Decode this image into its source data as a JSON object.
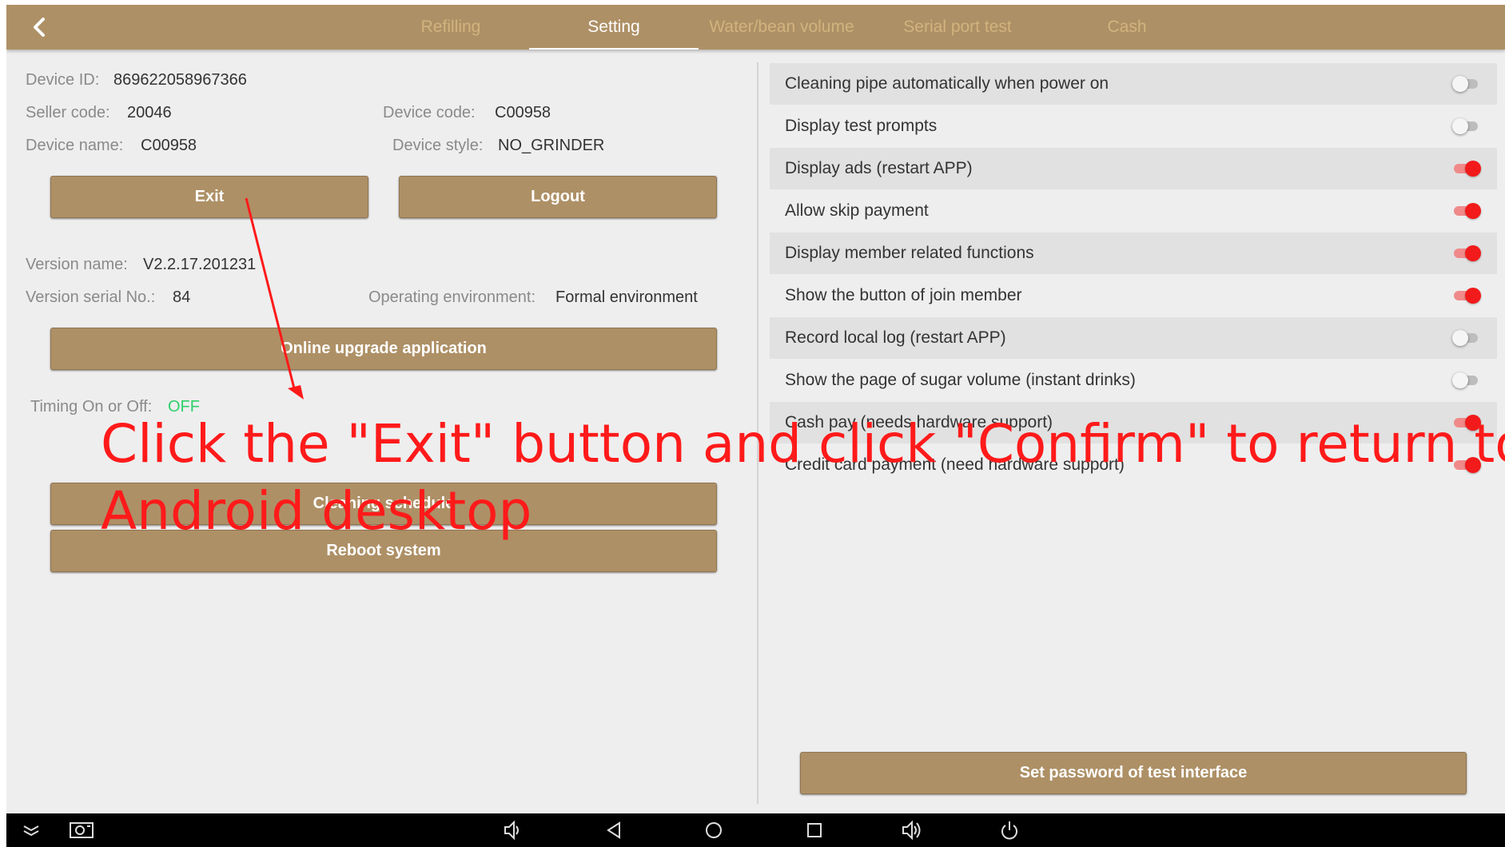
{
  "header": {
    "back_icon": "chevron-left-icon",
    "tabs": [
      {
        "label": "Refilling",
        "active": false
      },
      {
        "label": "Setting",
        "active": true
      },
      {
        "label": "Water/bean volume",
        "active": false
      },
      {
        "label": "Serial port test",
        "active": false
      },
      {
        "label": "Cash",
        "active": false
      }
    ]
  },
  "device": {
    "id_label": "Device ID:",
    "id_value": "869622058967366",
    "seller_label": "Seller code:",
    "seller_value": "20046",
    "code_label": "Device code:",
    "code_value": "C00958",
    "name_label": "Device name:",
    "name_value": "C00958",
    "style_label": "Device style:",
    "style_value": "NO_GRINDER"
  },
  "buttons": {
    "exit": "Exit",
    "logout": "Logout",
    "upgrade": "Online upgrade application",
    "cleaning": "Cleaning schedule",
    "reboot": "Reboot system",
    "set_password": "Set password of test interface"
  },
  "version": {
    "name_label": "Version name:",
    "name_value": "V2.2.17.201231",
    "serial_label": "Version serial No.:",
    "serial_value": "84",
    "env_label": "Operating environment:",
    "env_value": "Formal environment"
  },
  "timing": {
    "label": "Timing On or Off:",
    "value": "OFF"
  },
  "settings": [
    {
      "label": "Cleaning pipe automatically when power on",
      "on": false
    },
    {
      "label": "Display test prompts",
      "on": false
    },
    {
      "label": "Display ads (restart APP)",
      "on": true
    },
    {
      "label": "Allow skip payment",
      "on": true
    },
    {
      "label": "Display member related functions",
      "on": true
    },
    {
      "label": "Show the button of join member",
      "on": true
    },
    {
      "label": "Record local log (restart APP)",
      "on": false
    },
    {
      "label": "Show the page of sugar volume (instant drinks)",
      "on": false
    },
    {
      "label": "Cash pay (needs hardware support)",
      "on": true
    },
    {
      "label": "Credit card payment (need hardware support)",
      "on": true
    }
  ],
  "annotation": {
    "line1": "Click the \"Exit\" button and click \"Confirm\" to return to the",
    "line2": "Android desktop",
    "color": "#ff1a1a"
  },
  "navbar": {
    "icons": [
      "collapse-icon",
      "screenshot-icon",
      "volume-down-icon",
      "back-icon",
      "home-icon",
      "recents-icon",
      "volume-up-icon",
      "power-icon"
    ]
  },
  "colors": {
    "accent": "#ae9066",
    "tab_inactive": "#d2b37e",
    "toggle_on": "#f21a1a",
    "status_off": "#2fcf6b"
  }
}
